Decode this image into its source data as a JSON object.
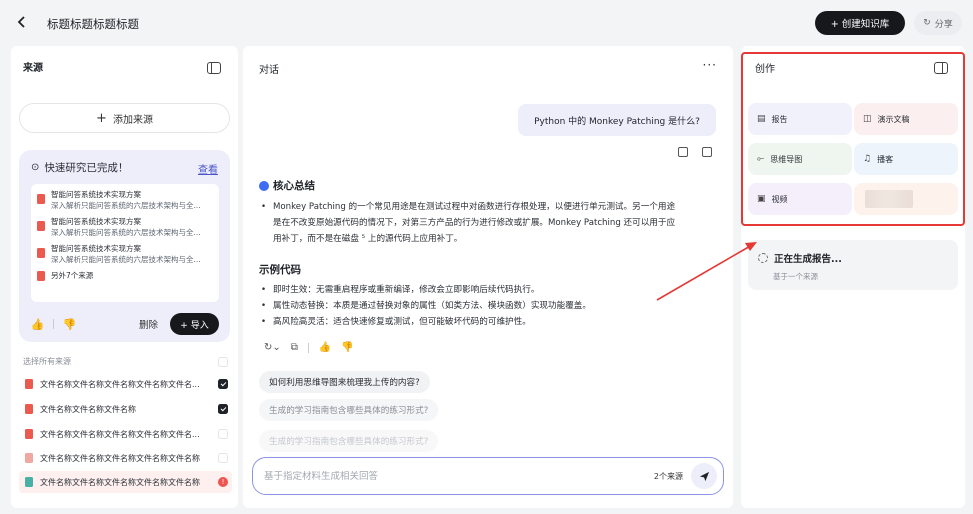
{
  "header": {
    "title": "标题标题标题标题",
    "create_label": "+ 创建知识库",
    "share_label": "分享"
  },
  "sources": {
    "heading": "来源",
    "add_label": "添加来源",
    "quick": {
      "heading": "快速研究已完成！",
      "view_label": "查看",
      "items": [
        {
          "title": "智能问答系统技术实现方案",
          "subtitle": "深入解析只能问答系统的六层技术架构与全..."
        },
        {
          "title": "智能问答系统技术实现方案",
          "subtitle": "深入解析只能问答系统的六层技术架构与全..."
        },
        {
          "title": "智能问答系统技术实现方案",
          "subtitle": "深入解析只能问答系统的六层技术架构与全..."
        }
      ],
      "more_label": "另外7个来源",
      "delete_label": "删除",
      "import_label": "+ 导入"
    },
    "select_all_label": "选择所有来源",
    "files": [
      {
        "name": "文件名称文件名称文件名称文件名称文件名...",
        "checked": true
      },
      {
        "name": "文件名称文件名称文件名称",
        "checked": true
      },
      {
        "name": "文件名称文件名称文件名称文件名称文件名...",
        "checked": false
      },
      {
        "name": "文件名称文件名称文件名称文件名称文件名称",
        "checked": false
      },
      {
        "name": "文件名称文件名称文件名称文件名称文件名称",
        "checked": false
      }
    ]
  },
  "chat": {
    "heading": "对话",
    "more_label": "···",
    "user_question": "Python 中的 Monkey Patching 是什么?",
    "summary_heading": "核心总结",
    "summary_text": "Monkey Patching 的一个常见用途是在测试过程中对函数进行存根处理，以便进行单元测试。另一个用途是在不改变原始源代码的情况下，对第三方产品的行为进行修改或扩展。Monkey Patching 还可以用于应用补丁，而不是在磁盘 ⁵ 上的源代码上应用补丁。",
    "example_heading": "示例代码",
    "examples": [
      "即时生效：无需重启程序或重新编译，修改会立即影响后续代码执行。",
      "属性动态替换：本质是通过替换对象的属性（如类方法、模块函数）实现功能覆盖。",
      "高风险高灵活：适合快速修复或测试，但可能破坏代码的可维护性。"
    ],
    "suggestions": [
      "如何利用思维导图来梳理我上传的内容?",
      "生成的学习指南包含哪些具体的练习形式?",
      "生成的学习指南包含哪些具体的练习形式?"
    ],
    "input_placeholder": "基于指定材料生成相关回答",
    "source_count": "2个来源"
  },
  "create": {
    "heading": "创作",
    "tiles": [
      {
        "label": "报告",
        "icon": "report-icon"
      },
      {
        "label": "演示文稿",
        "icon": "slides-icon"
      },
      {
        "label": "思维导图",
        "icon": "mindmap-icon"
      },
      {
        "label": "播客",
        "icon": "headphones-icon"
      },
      {
        "label": "视频",
        "icon": "video-icon"
      }
    ],
    "generating_title": "正在生成报告...",
    "generating_sub": "基于一个来源"
  },
  "colors": {
    "highlight": "#e53935",
    "accent": "#4b55c9",
    "primary_dark": "#16181c"
  }
}
